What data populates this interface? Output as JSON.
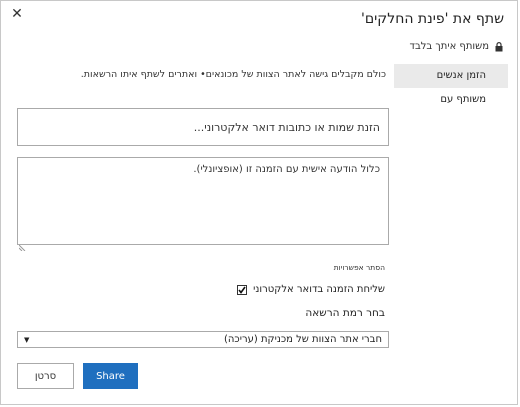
{
  "dialog": {
    "title": "שתף את 'פינת החלקים'",
    "close_glyph": "✕",
    "shared_status": "משותף איתך בלבד"
  },
  "tabs": [
    {
      "label": "הזמן אנשים",
      "active": true
    },
    {
      "label": "משותף עם",
      "active": false
    }
  ],
  "intro_text": "כולם מקבלים גישה לאתר הצוות של מכונאים• ואתרים לשתף איתו הרשאות.",
  "names_input": {
    "placeholder": "הזנת שמות או כתובות דואר אלקטרוני..."
  },
  "message_input": {
    "placeholder": "כלול הודעה אישית עם הזמנה זו (אופציונלי)."
  },
  "options": {
    "hide_label": "הסתר אפשרויות",
    "email_invite_label": "שליחת הזמנה בדואר אלקטרוני",
    "email_invite_checked": true
  },
  "permission": {
    "label": "בחר רמת הרשאה",
    "selected": "חברי אתר הצוות של מכניקת (עריכה)"
  },
  "buttons": {
    "share": "Share",
    "cancel": "סרטן"
  },
  "colors": {
    "accent": "#1f6fbf"
  }
}
